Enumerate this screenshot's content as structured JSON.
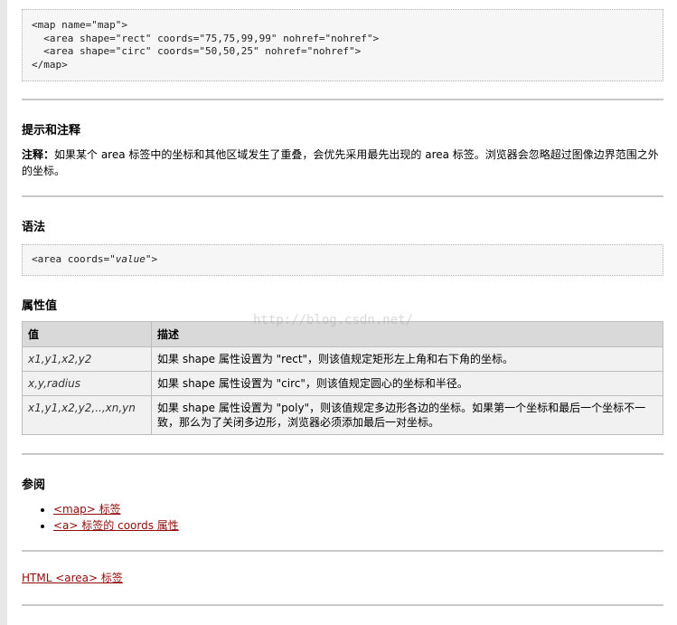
{
  "map_example": {
    "lines": [
      "<map name=\"map\">",
      "  <area shape=\"rect\" coords=\"75,75,99,99\" nohref=\"nohref\">",
      "  <area shape=\"circ\" coords=\"50,50,25\" nohref=\"nohref\">",
      "</map>"
    ]
  },
  "tips": {
    "heading": "提示和注释",
    "note_label": "注释：",
    "note_text": "如果某个 area 标签中的坐标和其他区域发生了重叠，会优先采用最先出现的 area 标签。浏览器会忽略超过图像边界范围之外的坐标。"
  },
  "syntax": {
    "heading": "语法",
    "code_prefix": "<area coords=\"",
    "code_value": "value",
    "code_suffix": "\">"
  },
  "attributes": {
    "heading": "属性值",
    "columns": [
      "值",
      "描述"
    ],
    "rows": [
      {
        "value": "x1,y1,x2,y2",
        "desc": "如果 shape 属性设置为 \"rect\"，则该值规定矩形左上角和右下角的坐标。"
      },
      {
        "value": "x,y,radius",
        "desc": "如果 shape 属性设置为 \"circ\"，则该值规定圆心的坐标和半径。"
      },
      {
        "value": "x1,y1,x2,y2,..,xn,yn",
        "desc": "如果 shape 属性设置为 \"poly\"，则该值规定多边形各边的坐标。如果第一个坐标和最后一个坐标不一致，那么为了关闭多边形，浏览器必须添加最后一对坐标。"
      }
    ]
  },
  "see_also": {
    "heading": "参阅",
    "links": [
      "<map> 标签",
      "<a> 标签的 coords 属性"
    ]
  },
  "footer_link": "HTML <area> 标签",
  "watermark": "http://blog.csdn.net/",
  "colors": {
    "link": "#900b09",
    "code_bg": "#f6f6f6",
    "table_header_bg": "#d9d9d9",
    "table_cell_bg": "#f1f1f1"
  }
}
